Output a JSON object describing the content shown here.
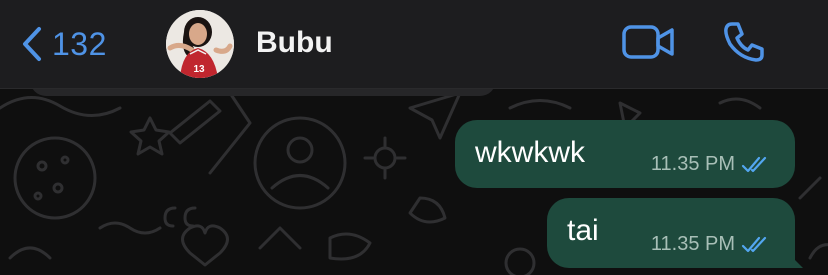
{
  "header": {
    "back_count": "132",
    "contact_name": "Bubu",
    "avatar_alt": "13"
  },
  "messages": [
    {
      "text": "wkwkwk",
      "time": "11.35 PM",
      "status": "read"
    },
    {
      "text": "tai",
      "time": "11.35 PM",
      "status": "read"
    }
  ],
  "colors": {
    "accent": "#4f93e6",
    "header_bg": "#1d1d1f",
    "bubble_out": "#1e4a3d",
    "read_tick": "#53a6f0",
    "wallpaper_doodle": "#2e2e30"
  },
  "icons": {
    "back": "chevron-left-icon",
    "video": "video-call-icon",
    "phone": "phone-call-icon",
    "read": "double-check-icon"
  }
}
